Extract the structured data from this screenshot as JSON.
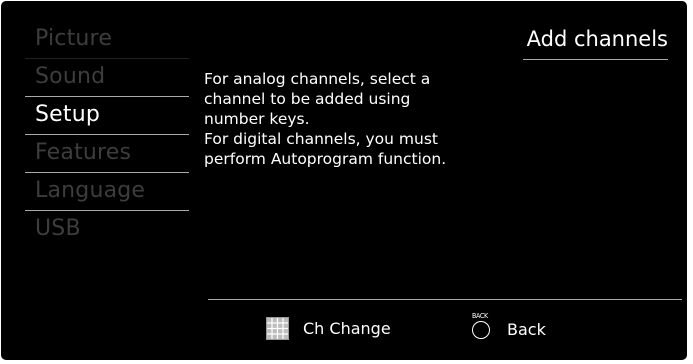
{
  "menu": {
    "items": [
      {
        "label": "Picture",
        "active": false
      },
      {
        "label": "Sound",
        "active": false
      },
      {
        "label": "Setup",
        "active": true
      },
      {
        "label": "Features",
        "active": false
      },
      {
        "label": "Language",
        "active": false
      },
      {
        "label": "USB",
        "active": false
      }
    ]
  },
  "page": {
    "title": "Add channels"
  },
  "description": {
    "lines": [
      "For analog channels, select a\nchannel to be added using\nnumber keys.",
      "For digital channels, you must\nperform Autoprogram function."
    ]
  },
  "footer": {
    "ch_change": {
      "label": "Ch Change",
      "icon": "number-grid-icon"
    },
    "back": {
      "label": "Back",
      "icon": "back-button-icon",
      "icon_text": "BACK"
    }
  },
  "colors": {
    "background": "#000000",
    "active_text": "#ffffff",
    "inactive_text": "#3d3d3d",
    "divider": "#aaaaaa"
  }
}
